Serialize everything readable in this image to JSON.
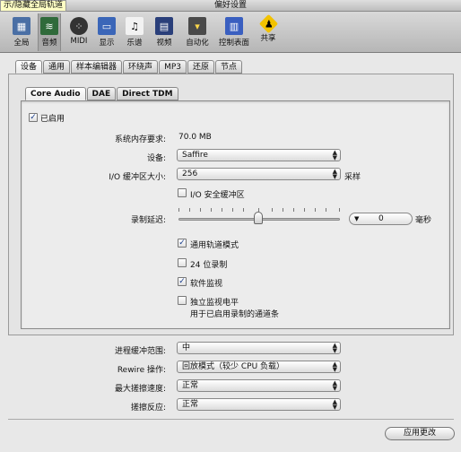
{
  "window": {
    "title": "偏好设置",
    "tooltip": "示/隐藏全局轨道"
  },
  "toolbar": {
    "items": [
      {
        "label": "全局",
        "icon": "global-prefs-icon"
      },
      {
        "label": "音频",
        "icon": "audio-prefs-icon"
      },
      {
        "label": "MIDI",
        "icon": "midi-prefs-icon"
      },
      {
        "label": "显示",
        "icon": "display-prefs-icon"
      },
      {
        "label": "乐谱",
        "icon": "score-prefs-icon"
      },
      {
        "label": "视频",
        "icon": "video-prefs-icon"
      },
      {
        "label": "自动化",
        "icon": "automation-prefs-icon"
      },
      {
        "label": "控制表面",
        "icon": "control-surfaces-icon"
      },
      {
        "label": "共享",
        "icon": "sharing-icon"
      }
    ],
    "active": "音频"
  },
  "tabs": [
    "设备",
    "通用",
    "样本编辑器",
    "环绕声",
    "MP3",
    "还原",
    "节点"
  ],
  "subtabs": [
    "Core Audio",
    "DAE",
    "Direct TDM"
  ],
  "core_audio": {
    "enabled_label": "已启用",
    "memory_label": "系统内存要求:",
    "memory_value": "70.0 MB",
    "device_label": "设备:",
    "device_value": "Saffire",
    "buffer_label": "I/O 缓冲区大小:",
    "buffer_value": "256",
    "buffer_unit": "采样",
    "safety_buffer_label": "I/O 安全缓冲区",
    "delay_label": "录制延迟:",
    "delay_value": "0",
    "delay_unit": "毫秒",
    "universal_track_label": "通用轨道模式",
    "bit24_label": "24 位录制",
    "software_monitor_label": "软件监视",
    "independent_monitor_label": "独立监视电平",
    "independent_monitor_note": "用于已启用录制的通道条"
  },
  "checkbox_states": {
    "enabled": true,
    "safety_buffer": false,
    "universal_track": true,
    "bit24": false,
    "software_monitor": true,
    "independent_monitor": false
  },
  "bottom": {
    "process_buffer_label": "进程缓冲范围:",
    "process_buffer_value": "中",
    "rewire_label": "Rewire 操作:",
    "rewire_value": "回放模式（较少 CPU 负载）",
    "scrub_speed_label": "最大搓擦速度:",
    "scrub_speed_value": "正常",
    "scrub_response_label": "搓擦反应:",
    "scrub_response_value": "正常",
    "apply_button": "应用更改"
  }
}
